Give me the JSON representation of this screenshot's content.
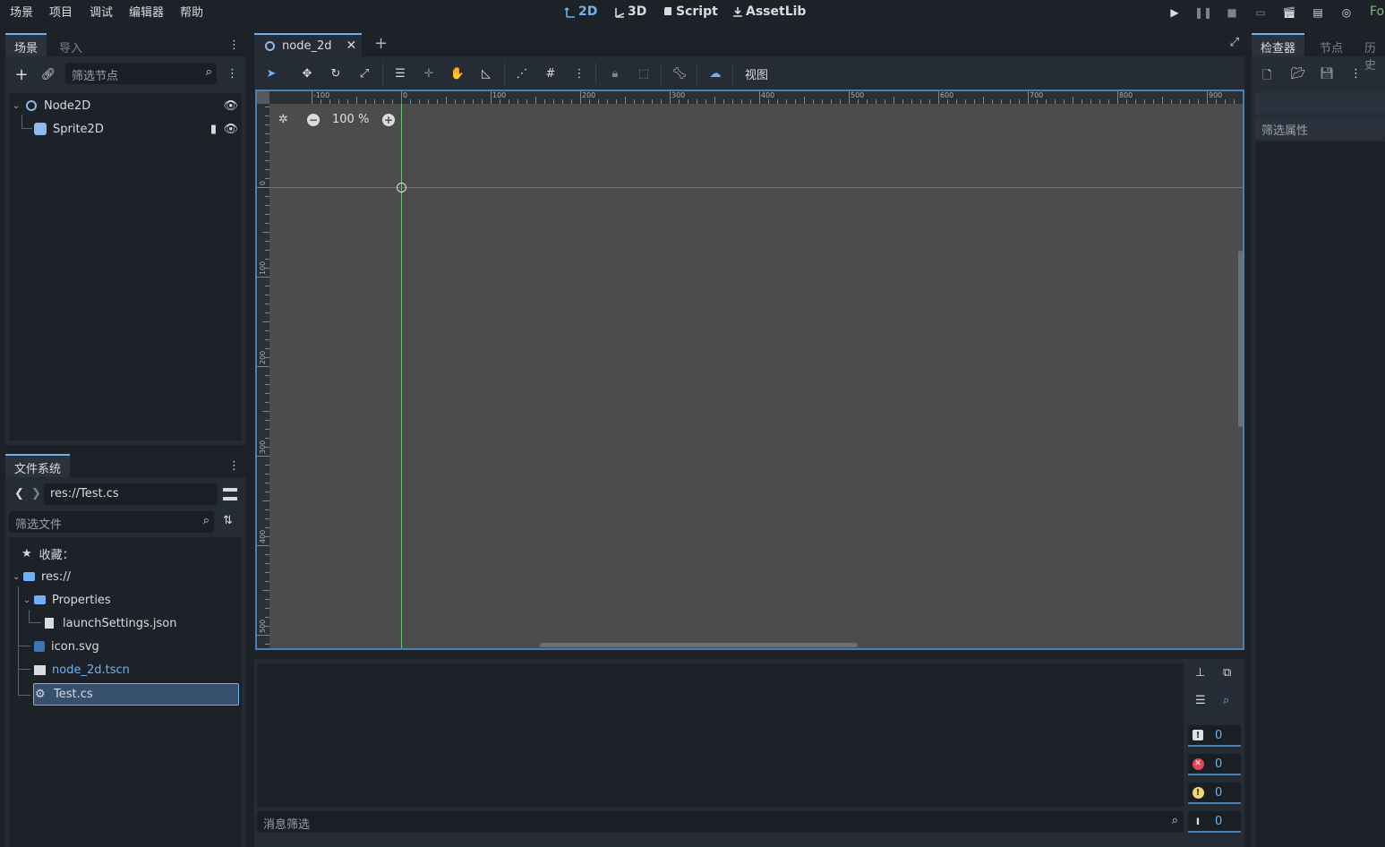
{
  "menu": [
    "场景",
    "项目",
    "调试",
    "编辑器",
    "帮助"
  ],
  "main_tabs": {
    "t2d": "2D",
    "t3d": "3D",
    "script": "Script",
    "assetlib": "AssetLib"
  },
  "right_cut": "Fo",
  "scene_dock": {
    "tabs": [
      "场景",
      "导入"
    ],
    "filter_placeholder": "筛选节点",
    "nodes": [
      {
        "name": "Node2D"
      },
      {
        "name": "Sprite2D"
      }
    ]
  },
  "filesystem": {
    "tab": "文件系统",
    "path": "res://Test.cs",
    "filter_placeholder": "筛选文件",
    "favorites": "收藏：",
    "items": [
      "res://",
      "Properties",
      "launchSettings.json",
      "icon.svg",
      "node_2d.tscn",
      "Test.cs"
    ]
  },
  "editor_tab": {
    "name": "node_2d"
  },
  "toolbar": {
    "view_label": "视图"
  },
  "zoom": {
    "label": "100 %"
  },
  "ruler": {
    "h_labels": [
      "-100",
      "0",
      "100",
      "200",
      "300",
      "400",
      "500",
      "600",
      "700",
      "800",
      "900"
    ],
    "v_labels": [
      "0",
      "100",
      "200",
      "300",
      "400",
      "500"
    ]
  },
  "inspector": {
    "tabs": [
      "检查器",
      "节点",
      "历史"
    ],
    "filter_label": "筛选属性"
  },
  "output": {
    "filter_placeholder": "消息筛选",
    "counts": {
      "messages": "0",
      "errors": "0",
      "warnings": "0",
      "editor": "0"
    }
  },
  "colors": {
    "accent": "#6fb0f2",
    "selection": "#36506d",
    "x_axis": "#d04a4a",
    "y_axis": "#6fc26f"
  }
}
